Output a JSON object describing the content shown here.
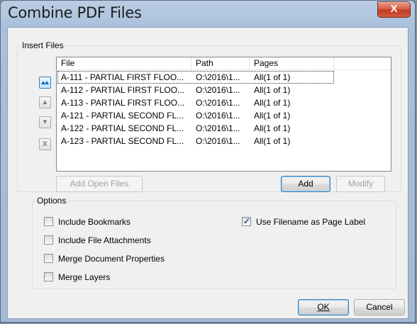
{
  "window": {
    "title": "Combine PDF Files",
    "close_glyph": "X"
  },
  "insert_files": {
    "group_label": "Insert Files",
    "columns": [
      "File",
      "Path",
      "Pages"
    ],
    "rows": [
      {
        "file": "A-111 - PARTIAL FIRST FLOO...",
        "path": "O:\\2016\\1...",
        "pages": "All(1 of 1)"
      },
      {
        "file": "A-112 - PARTIAL FIRST FLOO...",
        "path": "O:\\2016\\1...",
        "pages": "All(1 of 1)"
      },
      {
        "file": "A-113 - PARTIAL FIRST FLOO...",
        "path": "O:\\2016\\1...",
        "pages": "All(1 of 1)"
      },
      {
        "file": "A-121 - PARTIAL SECOND FL...",
        "path": "O:\\2016\\1...",
        "pages": "All(1 of 1)"
      },
      {
        "file": "A-122 - PARTIAL SECOND FL...",
        "path": "O:\\2016\\1...",
        "pages": "All(1 of 1)"
      },
      {
        "file": "A-123 - PARTIAL SECOND FL...",
        "path": "O:\\2016\\1...",
        "pages": "All(1 of 1)"
      }
    ],
    "side_buttons": {
      "move_top_icon": "double-triangle-up-icon",
      "move_up_glyph": "▲",
      "move_down_glyph": "▼",
      "remove_glyph": "X"
    },
    "add_open_files_label": "Add Open Files",
    "add_label": "Add",
    "modify_label": "Modify"
  },
  "options": {
    "group_label": "Options",
    "include_bookmarks": {
      "label": "Include Bookmarks",
      "checked": false
    },
    "include_file_attachments": {
      "label": "Include File Attachments",
      "checked": false
    },
    "merge_document_properties": {
      "label": "Merge Document Properties",
      "checked": false
    },
    "merge_layers": {
      "label": "Merge Layers",
      "checked": false
    },
    "use_filename_as_page_label": {
      "label": "Use Filename as Page Label",
      "checked": true,
      "check_glyph": "✓"
    }
  },
  "footer": {
    "ok_label": "OK",
    "cancel_label": "Cancel"
  },
  "colors": {
    "title_bar": "#b9cde4",
    "close_button": "#c03a22",
    "dialog_bg": "#f0f0f0",
    "focus_blue": "#3c7fb1"
  }
}
